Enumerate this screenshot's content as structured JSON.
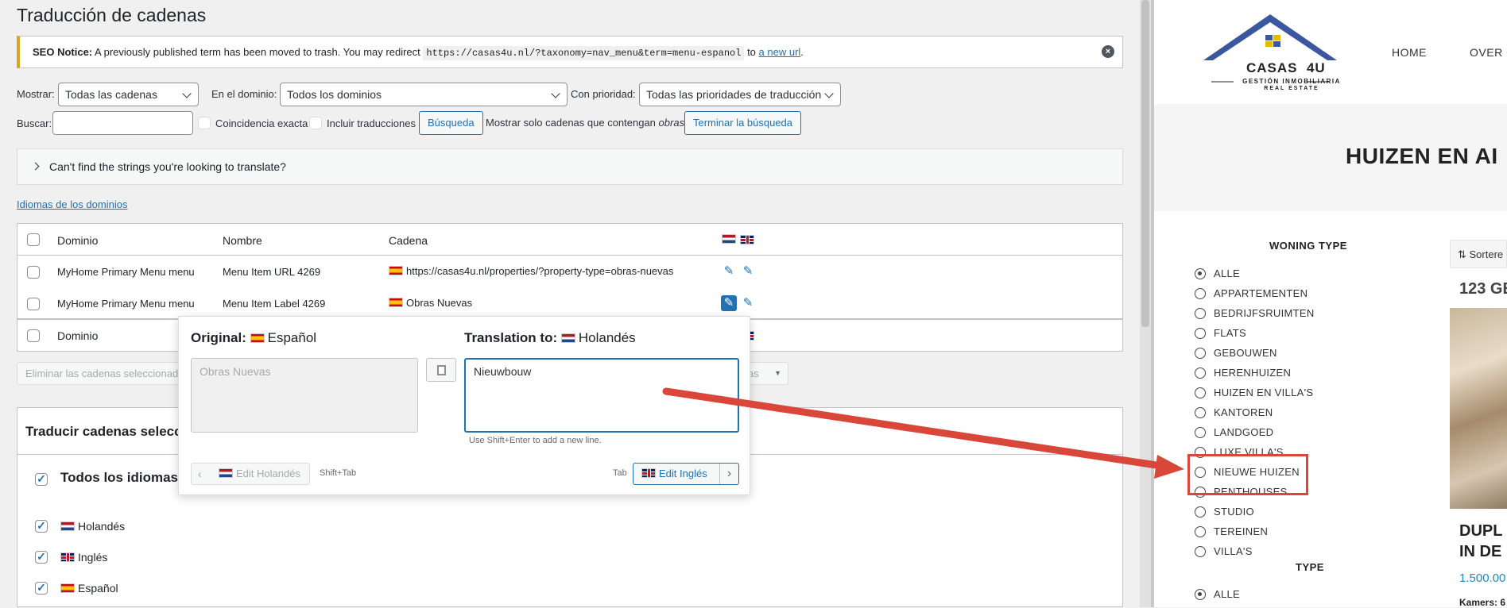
{
  "left": {
    "title": "Traducción de cadenas",
    "seo_notice": {
      "label": "SEO Notice:",
      "text": " A previously published term has been moved to trash. You may redirect ",
      "code": "https://casas4u.nl/?taxonomy=nav_menu&term=menu-espanol",
      "to": " to ",
      "link": "a new url",
      "end": "."
    },
    "filters": {
      "mostrar_label": "Mostrar:",
      "mostrar_value": "Todas las cadenas",
      "dominio_label": "En el dominio:",
      "dominio_value": "Todos los dominios",
      "prioridad_label": "Con prioridad:",
      "prioridad_value": "Todas las prioridades de traducción",
      "buscar_label": "Buscar:",
      "coincidencia": "Coincidencia exacta",
      "incluir": "Incluir traducciones",
      "busqueda_btn": "Búsqueda",
      "mostrar_solo": "Mostrar solo cadenas que contengan",
      "mostrar_solo_term": "obras",
      "terminar_btn": "Terminar la búsqueda"
    },
    "cant_find": "Can't find the strings you're looking to translate?",
    "idiomas_link": "Idiomas de los dominios",
    "table": {
      "headers": [
        "Dominio",
        "Nombre",
        "Cadena"
      ],
      "rows": [
        {
          "dominio": "MyHome Primary Menu menu",
          "nombre": "Menu Item URL 4269",
          "cadena": "https://casas4u.nl/properties/?property-type=obras-nuevas"
        },
        {
          "dominio": "MyHome Primary Menu menu",
          "nombre": "Menu Item Label 4269",
          "cadena": "Obras Nuevas"
        }
      ],
      "footer": "Dominio"
    },
    "bulk": {
      "delete_label": "Eliminar las cadenas seleccionada",
      "select_suffix": "as"
    },
    "popup": {
      "original_label": "Original:",
      "original_lang": "Español",
      "translation_label": "Translation to:",
      "translation_lang": "Holandés",
      "original_text": "Obras Nuevas",
      "translation_text": "Nieuwbouw",
      "hint": "Use Shift+Enter to add a new line.",
      "prev_btn": "Edit Holandés",
      "prev_shortcut": "Shift+Tab",
      "next_shortcut": "Tab",
      "next_btn": "Edit Inglés"
    },
    "translate_section": {
      "title": "Traducir cadenas seleccio",
      "all_languages": "Todos los idiomas",
      "languages": [
        "Holandés",
        "Inglés",
        "Español"
      ]
    }
  },
  "right": {
    "logo": {
      "line1": "CASAS",
      "line2": "4U",
      "sub1": "GESTIÓN INMOBILIARIA",
      "sub2": "REAL  ESTATE"
    },
    "nav": [
      "HOME",
      "OVER O"
    ],
    "hero_title": "HUIZEN EN AI",
    "woning_type_title": "WONING TYPE",
    "woning_types": [
      "ALLE",
      "APPARTEMENTEN",
      "BEDRIJFSRUIMTEN",
      "FLATS",
      "GEBOUWEN",
      "HERENHUIZEN",
      "HUIZEN EN VILLA'S",
      "KANTOREN",
      "LANDGOED",
      "LUXE VILLA'S",
      "NIEUWE HUIZEN",
      "PENTHOUSES",
      "STUDIO",
      "TEREINEN",
      "VILLA'S"
    ],
    "type_title": "TYPE",
    "type_options": [
      "ALLE"
    ],
    "sort_label": "Sortere",
    "count": "123 GE",
    "listing_title_1": "DUPL",
    "listing_title_2": "IN DE",
    "price": "1.500.00",
    "kamers": "Kamers: 6"
  },
  "colors": {
    "accent": "#2271b1",
    "annotation_red": "#d9463a",
    "notice_border": "#dba617"
  }
}
